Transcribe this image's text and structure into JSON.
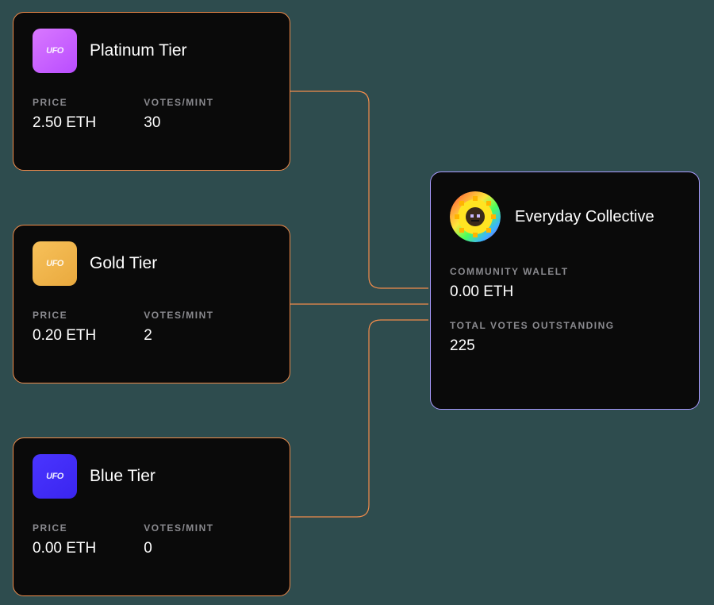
{
  "labels": {
    "price": "PRICE",
    "votesPerMint": "VOTES/MINT",
    "communityWallet": "COMMUNITY WALELT",
    "totalVotesOutstanding": "TOTAL VOTES OUTSTANDING"
  },
  "tiers": [
    {
      "name": "Platinum Tier",
      "price": "2.50 ETH",
      "votes": "30",
      "iconBg": "linear-gradient(140deg,#d978ff 0%,#b94dff 100%)",
      "iconText": "UFO"
    },
    {
      "name": "Gold Tier",
      "price": "0.20 ETH",
      "votes": "2",
      "iconBg": "linear-gradient(140deg,#f7c15a 0%,#e9a93e 100%)",
      "iconText": "UFO"
    },
    {
      "name": "Blue Tier",
      "price": "0.00 ETH",
      "votes": "0",
      "iconBg": "linear-gradient(140deg,#4a35ff 0%,#3a25ef 100%)",
      "iconText": "UFO"
    }
  ],
  "collective": {
    "name": "Everyday Collective",
    "communityWallet": "0.00 ETH",
    "totalVotesOutstanding": "225"
  }
}
